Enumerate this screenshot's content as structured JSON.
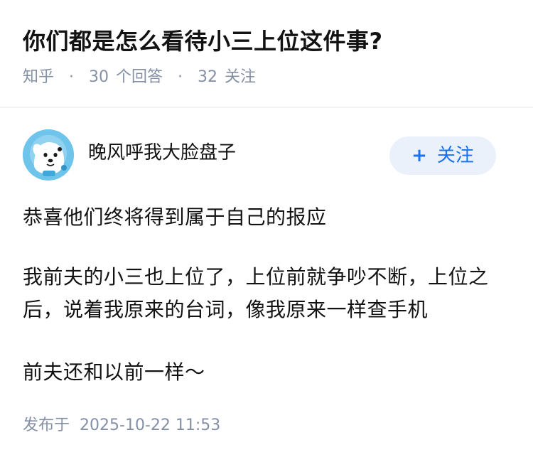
{
  "question": {
    "title": "你们都是怎么看待小三上位这件事?",
    "source": "知乎",
    "answer_count": "30",
    "answer_label": "个回答",
    "follower_count": "32",
    "follower_label": "关注",
    "separator": "·"
  },
  "author": {
    "name": "晚风呼我大脸盘子",
    "avatar_icon": "cartoon-dog-astronaut-avatar",
    "follow_plus": "+",
    "follow_label": "关注"
  },
  "answer": {
    "paragraphs": [
      "恭喜他们终将得到属于自己的报应",
      "我前夫的小三也上位了，上位前就争吵不断，上位之后，说着我原来的台词，像我原来一样查手机",
      "前夫还和以前一样～"
    ],
    "published_label": "发布于",
    "published_time": "2025-10-22 11:53"
  },
  "colors": {
    "accent": "#1772f6",
    "follow_bg": "#ebf1fb",
    "meta_text": "#8590a6",
    "avatar_bg": "#6ec4ea"
  }
}
